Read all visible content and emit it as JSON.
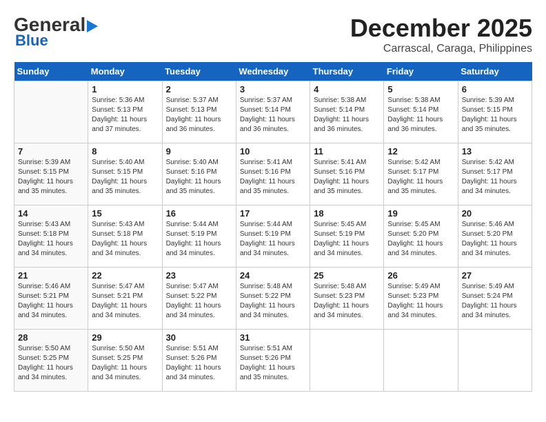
{
  "header": {
    "logo_general": "General",
    "logo_blue": "Blue",
    "title": "December 2025",
    "subtitle": "Carrascal, Caraga, Philippines"
  },
  "weekdays": [
    "Sunday",
    "Monday",
    "Tuesday",
    "Wednesday",
    "Thursday",
    "Friday",
    "Saturday"
  ],
  "weeks": [
    [
      {
        "day": "",
        "info": ""
      },
      {
        "day": "1",
        "info": "Sunrise: 5:36 AM\nSunset: 5:13 PM\nDaylight: 11 hours\nand 37 minutes."
      },
      {
        "day": "2",
        "info": "Sunrise: 5:37 AM\nSunset: 5:13 PM\nDaylight: 11 hours\nand 36 minutes."
      },
      {
        "day": "3",
        "info": "Sunrise: 5:37 AM\nSunset: 5:14 PM\nDaylight: 11 hours\nand 36 minutes."
      },
      {
        "day": "4",
        "info": "Sunrise: 5:38 AM\nSunset: 5:14 PM\nDaylight: 11 hours\nand 36 minutes."
      },
      {
        "day": "5",
        "info": "Sunrise: 5:38 AM\nSunset: 5:14 PM\nDaylight: 11 hours\nand 36 minutes."
      },
      {
        "day": "6",
        "info": "Sunrise: 5:39 AM\nSunset: 5:15 PM\nDaylight: 11 hours\nand 35 minutes."
      }
    ],
    [
      {
        "day": "7",
        "info": "Sunrise: 5:39 AM\nSunset: 5:15 PM\nDaylight: 11 hours\nand 35 minutes."
      },
      {
        "day": "8",
        "info": "Sunrise: 5:40 AM\nSunset: 5:15 PM\nDaylight: 11 hours\nand 35 minutes."
      },
      {
        "day": "9",
        "info": "Sunrise: 5:40 AM\nSunset: 5:16 PM\nDaylight: 11 hours\nand 35 minutes."
      },
      {
        "day": "10",
        "info": "Sunrise: 5:41 AM\nSunset: 5:16 PM\nDaylight: 11 hours\nand 35 minutes."
      },
      {
        "day": "11",
        "info": "Sunrise: 5:41 AM\nSunset: 5:16 PM\nDaylight: 11 hours\nand 35 minutes."
      },
      {
        "day": "12",
        "info": "Sunrise: 5:42 AM\nSunset: 5:17 PM\nDaylight: 11 hours\nand 35 minutes."
      },
      {
        "day": "13",
        "info": "Sunrise: 5:42 AM\nSunset: 5:17 PM\nDaylight: 11 hours\nand 34 minutes."
      }
    ],
    [
      {
        "day": "14",
        "info": "Sunrise: 5:43 AM\nSunset: 5:18 PM\nDaylight: 11 hours\nand 34 minutes."
      },
      {
        "day": "15",
        "info": "Sunrise: 5:43 AM\nSunset: 5:18 PM\nDaylight: 11 hours\nand 34 minutes."
      },
      {
        "day": "16",
        "info": "Sunrise: 5:44 AM\nSunset: 5:19 PM\nDaylight: 11 hours\nand 34 minutes."
      },
      {
        "day": "17",
        "info": "Sunrise: 5:44 AM\nSunset: 5:19 PM\nDaylight: 11 hours\nand 34 minutes."
      },
      {
        "day": "18",
        "info": "Sunrise: 5:45 AM\nSunset: 5:19 PM\nDaylight: 11 hours\nand 34 minutes."
      },
      {
        "day": "19",
        "info": "Sunrise: 5:45 AM\nSunset: 5:20 PM\nDaylight: 11 hours\nand 34 minutes."
      },
      {
        "day": "20",
        "info": "Sunrise: 5:46 AM\nSunset: 5:20 PM\nDaylight: 11 hours\nand 34 minutes."
      }
    ],
    [
      {
        "day": "21",
        "info": "Sunrise: 5:46 AM\nSunset: 5:21 PM\nDaylight: 11 hours\nand 34 minutes."
      },
      {
        "day": "22",
        "info": "Sunrise: 5:47 AM\nSunset: 5:21 PM\nDaylight: 11 hours\nand 34 minutes."
      },
      {
        "day": "23",
        "info": "Sunrise: 5:47 AM\nSunset: 5:22 PM\nDaylight: 11 hours\nand 34 minutes."
      },
      {
        "day": "24",
        "info": "Sunrise: 5:48 AM\nSunset: 5:22 PM\nDaylight: 11 hours\nand 34 minutes."
      },
      {
        "day": "25",
        "info": "Sunrise: 5:48 AM\nSunset: 5:23 PM\nDaylight: 11 hours\nand 34 minutes."
      },
      {
        "day": "26",
        "info": "Sunrise: 5:49 AM\nSunset: 5:23 PM\nDaylight: 11 hours\nand 34 minutes."
      },
      {
        "day": "27",
        "info": "Sunrise: 5:49 AM\nSunset: 5:24 PM\nDaylight: 11 hours\nand 34 minutes."
      }
    ],
    [
      {
        "day": "28",
        "info": "Sunrise: 5:50 AM\nSunset: 5:25 PM\nDaylight: 11 hours\nand 34 minutes."
      },
      {
        "day": "29",
        "info": "Sunrise: 5:50 AM\nSunset: 5:25 PM\nDaylight: 11 hours\nand 34 minutes."
      },
      {
        "day": "30",
        "info": "Sunrise: 5:51 AM\nSunset: 5:26 PM\nDaylight: 11 hours\nand 34 minutes."
      },
      {
        "day": "31",
        "info": "Sunrise: 5:51 AM\nSunset: 5:26 PM\nDaylight: 11 hours\nand 35 minutes."
      },
      {
        "day": "",
        "info": ""
      },
      {
        "day": "",
        "info": ""
      },
      {
        "day": "",
        "info": ""
      }
    ]
  ]
}
